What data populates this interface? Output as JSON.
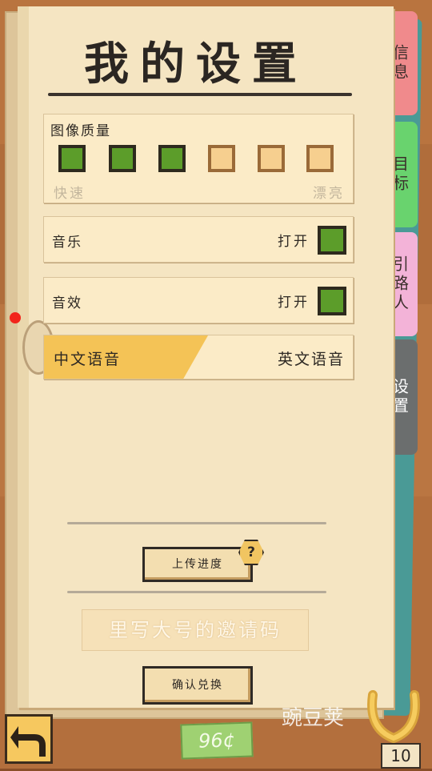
{
  "title": "我的设置",
  "quality": {
    "label": "图像质量",
    "hint_left": "快速",
    "hint_right": "漂亮",
    "levels": [
      true,
      true,
      true,
      false,
      false,
      false
    ]
  },
  "music": {
    "label": "音乐",
    "state": "打开",
    "enabled": true
  },
  "sfx": {
    "label": "音效",
    "state": "打开",
    "enabled": true
  },
  "voice": {
    "selected": "中文语音",
    "other": "英文语音"
  },
  "upload_button": "上传进度",
  "help_badge": "?",
  "invite_placeholder": "里写大号的邀请码",
  "redeem_button": "确认兑换",
  "tabs": [
    {
      "label": "信息",
      "color": "#f08a8c"
    },
    {
      "label": "目标",
      "color": "#69d36e"
    },
    {
      "label": "引路人",
      "color": "#f3b3d8"
    },
    {
      "label": "设置",
      "color": "#6b6e6e"
    }
  ],
  "currency": "96¢",
  "horseshoe_count": "10",
  "watermark": "豌豆荚",
  "colors": {
    "accent_yellow": "#f4c356",
    "checkbox_on": "#5c9d2a",
    "checkbox_off": "#f6cf8f",
    "wood": "#b7713f"
  }
}
